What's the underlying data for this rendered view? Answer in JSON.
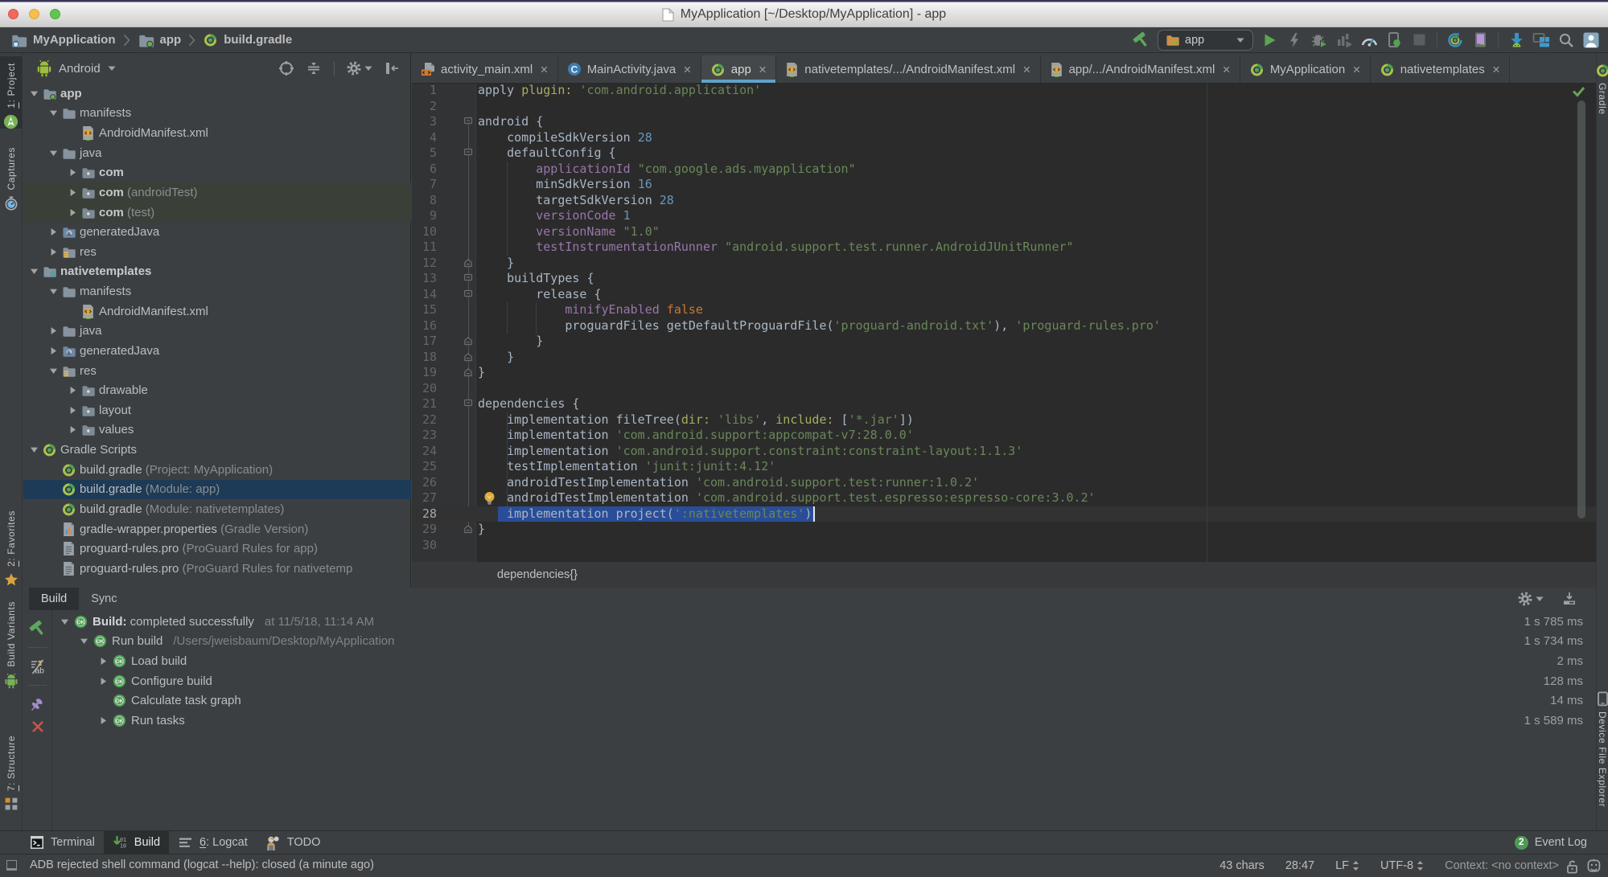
{
  "theme": {
    "panel_bg": "#3C3F41",
    "editor_bg": "#2B2B2B",
    "accent_blue": "#61A1C8",
    "selection_blue": "#2A4D97",
    "tree_selection_blue": "#1D3B57",
    "success_green": "#4D9C54",
    "error_red": "#C75450",
    "string_green": "#6A8759",
    "keyword_orange": "#CC7832",
    "number_blue": "#6897BB",
    "property_purple": "#9876AA"
  },
  "window": {
    "title": "MyApplication [~/Desktop/MyApplication] - app",
    "traffic_lights": [
      "close",
      "minimize",
      "zoom"
    ]
  },
  "navbar": {
    "breadcrumbs": [
      {
        "label": "MyApplication",
        "icon": "project-folder-icon"
      },
      {
        "label": "app",
        "icon": "module-folder-icon"
      },
      {
        "label": "build.gradle",
        "icon": "gradle-icon"
      }
    ],
    "run_config": {
      "label": "app",
      "icon": "run-config-folder-icon"
    },
    "actions": [
      {
        "id": "make",
        "icon": "hammer-icon"
      },
      {
        "id": "run-config-combo",
        "combo": true
      },
      {
        "id": "run",
        "icon": "run-icon"
      },
      {
        "id": "apply-changes",
        "icon": "lightning-icon"
      },
      {
        "id": "debug",
        "icon": "debug-icon"
      },
      {
        "id": "profile",
        "icon": "profile-icon"
      },
      {
        "id": "profiler",
        "icon": "gauge-icon"
      },
      {
        "id": "attach-debugger",
        "icon": "attach-debugger-icon"
      },
      {
        "id": "stop",
        "icon": "stop-icon"
      },
      {
        "sep": true
      },
      {
        "id": "sync-project",
        "icon": "gradle-sync-icon"
      },
      {
        "id": "layout-inspector",
        "icon": "layout-inspector-icon"
      },
      {
        "sep": true
      },
      {
        "id": "sdk-manager",
        "icon": "sdk-manager-icon"
      },
      {
        "id": "avd-manager",
        "icon": "avd-manager-icon"
      },
      {
        "id": "search-everywhere",
        "icon": "search-icon"
      },
      {
        "id": "profile-account",
        "icon": "avatar-icon"
      }
    ]
  },
  "left_stripe": {
    "top": [
      {
        "label": "1: Project",
        "icon": "android-studio-icon",
        "selected": true,
        "mnemonic": true
      },
      {
        "label": "Captures",
        "icon": "captures-icon"
      }
    ],
    "bottom": [
      {
        "label": "2: Favorites",
        "icon": "star-icon",
        "mnemonic": true
      },
      {
        "label": "Build Variants",
        "icon": "android-robot-icon"
      },
      {
        "label": "7: Structure",
        "icon": "structure-icon",
        "mnemonic": true
      }
    ]
  },
  "right_stripe": {
    "top": [
      {
        "label": "Gradle",
        "icon": "gradle-icon"
      }
    ],
    "bottom": [
      {
        "label": "Device File Explorer",
        "icon": "device-explorer-icon"
      }
    ]
  },
  "project_panel": {
    "view_selector": "Android",
    "header_actions": [
      "locate-icon",
      "collapse-all-icon",
      "separator",
      "gear-icon",
      "hide-panel-icon"
    ],
    "tree": [
      {
        "label": "app",
        "icon": "module-app-folder-icon",
        "level": 0,
        "arrow": "expanded",
        "bold": true
      },
      {
        "label": "manifests",
        "icon": "folder-icon",
        "level": 1,
        "arrow": "expanded"
      },
      {
        "label": "AndroidManifest.xml",
        "icon": "manifest-file-icon",
        "level": 2,
        "arrow": "none"
      },
      {
        "label": "java",
        "icon": "folder-icon",
        "level": 1,
        "arrow": "expanded"
      },
      {
        "label": "com",
        "icon": "package-icon",
        "level": 2,
        "arrow": "collapsed",
        "bold": true
      },
      {
        "label": "com",
        "suffix": " (androidTest)",
        "icon": "package-icon",
        "level": 2,
        "arrow": "collapsed",
        "bold": true,
        "highlight": true
      },
      {
        "label": "com",
        "suffix": " (test)",
        "icon": "package-icon",
        "level": 2,
        "arrow": "collapsed",
        "bold": true,
        "highlight": true
      },
      {
        "label": "generatedJava",
        "icon": "generated-folder-icon",
        "level": 1,
        "arrow": "collapsed"
      },
      {
        "label": "res",
        "icon": "res-folder-icon",
        "level": 1,
        "arrow": "collapsed"
      },
      {
        "label": "nativetemplates",
        "icon": "module-lib-folder-icon",
        "level": 0,
        "arrow": "expanded",
        "bold": true
      },
      {
        "label": "manifests",
        "icon": "folder-icon",
        "level": 1,
        "arrow": "expanded"
      },
      {
        "label": "AndroidManifest.xml",
        "icon": "manifest-file-icon",
        "level": 2,
        "arrow": "none"
      },
      {
        "label": "java",
        "icon": "folder-icon",
        "level": 1,
        "arrow": "collapsed"
      },
      {
        "label": "generatedJava",
        "icon": "generated-folder-icon",
        "level": 1,
        "arrow": "collapsed"
      },
      {
        "label": "res",
        "icon": "res-folder-icon",
        "level": 1,
        "arrow": "expanded"
      },
      {
        "label": "drawable",
        "icon": "package-icon",
        "level": 2,
        "arrow": "collapsed"
      },
      {
        "label": "layout",
        "icon": "package-icon",
        "level": 2,
        "arrow": "collapsed"
      },
      {
        "label": "values",
        "icon": "package-icon",
        "level": 2,
        "arrow": "collapsed"
      },
      {
        "label": "Gradle Scripts",
        "icon": "gradle-icon",
        "level": 0,
        "arrow": "expanded"
      },
      {
        "label": "build.gradle",
        "suffix": " (Project: MyApplication)",
        "icon": "gradle-icon",
        "level": 1,
        "arrow": "none"
      },
      {
        "label": "build.gradle",
        "suffix": " (Module: app)",
        "icon": "gradle-icon",
        "level": 1,
        "arrow": "none",
        "selected": true
      },
      {
        "label": "build.gradle",
        "suffix": " (Module: nativetemplates)",
        "icon": "gradle-icon",
        "level": 1,
        "arrow": "none"
      },
      {
        "label": "gradle-wrapper.properties",
        "suffix": " (Gradle Version)",
        "icon": "properties-file-icon",
        "level": 1,
        "arrow": "none"
      },
      {
        "label": "proguard-rules.pro",
        "suffix": " (ProGuard Rules for app)",
        "icon": "text-file-icon",
        "level": 1,
        "arrow": "none"
      },
      {
        "label": "proguard-rules.pro",
        "suffix": " (ProGuard Rules for nativetemp",
        "icon": "text-file-icon",
        "level": 1,
        "arrow": "none"
      }
    ]
  },
  "editor": {
    "tabs": [
      {
        "label": "activity_main.xml",
        "icon": "layout-file-icon"
      },
      {
        "label": "MainActivity.java",
        "icon": "class-file-icon"
      },
      {
        "label": "app",
        "icon": "gradle-icon",
        "selected": true
      },
      {
        "label": "nativetemplates/.../AndroidManifest.xml",
        "icon": "manifest-file-icon"
      },
      {
        "label": "app/.../AndroidManifest.xml",
        "icon": "manifest-file-icon"
      },
      {
        "label": "MyApplication",
        "icon": "gradle-icon"
      },
      {
        "label": "nativetemplates",
        "icon": "gradle-icon"
      }
    ],
    "breadcrumb": "dependencies{}",
    "caret_line": 28,
    "selection": {
      "line": 28,
      "text": "implementation project(':nativetemplates')"
    },
    "lightbulb_line": 27,
    "lines": [
      {
        "n": 1,
        "fold": "none",
        "tokens": [
          [
            "pln",
            "apply "
          ],
          [
            "mk",
            "plugin:"
          ],
          [
            "pln",
            " "
          ],
          [
            "str",
            "'com.android.application'"
          ]
        ]
      },
      {
        "n": 2,
        "fold": "none",
        "tokens": []
      },
      {
        "n": 3,
        "fold": "start",
        "tokens": [
          [
            "pln",
            "android {"
          ]
        ]
      },
      {
        "n": 4,
        "fold": "none",
        "tokens": [
          [
            "pln",
            "    compileSdkVersion "
          ],
          [
            "num",
            "28"
          ]
        ]
      },
      {
        "n": 5,
        "fold": "start",
        "tokens": [
          [
            "pln",
            "    defaultConfig {"
          ]
        ]
      },
      {
        "n": 6,
        "fold": "none",
        "tokens": [
          [
            "pln",
            "        "
          ],
          [
            "prop",
            "applicationId"
          ],
          [
            "pln",
            " "
          ],
          [
            "str",
            "\"com.google.ads.myapplication\""
          ]
        ]
      },
      {
        "n": 7,
        "fold": "none",
        "tokens": [
          [
            "pln",
            "        minSdkVersion "
          ],
          [
            "num",
            "16"
          ]
        ]
      },
      {
        "n": 8,
        "fold": "none",
        "tokens": [
          [
            "pln",
            "        targetSdkVersion "
          ],
          [
            "num",
            "28"
          ]
        ]
      },
      {
        "n": 9,
        "fold": "none",
        "tokens": [
          [
            "pln",
            "        "
          ],
          [
            "prop",
            "versionCode"
          ],
          [
            "pln",
            " "
          ],
          [
            "num",
            "1"
          ]
        ]
      },
      {
        "n": 10,
        "fold": "none",
        "tokens": [
          [
            "pln",
            "        "
          ],
          [
            "prop",
            "versionName"
          ],
          [
            "pln",
            " "
          ],
          [
            "str",
            "\"1.0\""
          ]
        ]
      },
      {
        "n": 11,
        "fold": "none",
        "tokens": [
          [
            "pln",
            "        "
          ],
          [
            "prop",
            "testInstrumentationRunner"
          ],
          [
            "pln",
            " "
          ],
          [
            "str",
            "\"android.support.test.runner.AndroidJUnitRunner\""
          ]
        ]
      },
      {
        "n": 12,
        "fold": "end",
        "tokens": [
          [
            "pln",
            "    }"
          ]
        ]
      },
      {
        "n": 13,
        "fold": "start",
        "tokens": [
          [
            "pln",
            "    buildTypes {"
          ]
        ]
      },
      {
        "n": 14,
        "fold": "start",
        "tokens": [
          [
            "pln",
            "        release {"
          ]
        ]
      },
      {
        "n": 15,
        "fold": "none",
        "tokens": [
          [
            "pln",
            "            "
          ],
          [
            "prop",
            "minifyEnabled"
          ],
          [
            "pln",
            " "
          ],
          [
            "kw",
            "false"
          ]
        ]
      },
      {
        "n": 16,
        "fold": "none",
        "tokens": [
          [
            "pln",
            "            proguardFiles getDefaultProguardFile("
          ],
          [
            "str",
            "'proguard-android.txt'"
          ],
          [
            "pln",
            "), "
          ],
          [
            "str",
            "'proguard-rules.pro'"
          ]
        ]
      },
      {
        "n": 17,
        "fold": "end",
        "tokens": [
          [
            "pln",
            "        }"
          ]
        ]
      },
      {
        "n": 18,
        "fold": "end",
        "tokens": [
          [
            "pln",
            "    }"
          ]
        ]
      },
      {
        "n": 19,
        "fold": "end",
        "tokens": [
          [
            "pln",
            "}"
          ]
        ]
      },
      {
        "n": 20,
        "fold": "none",
        "tokens": []
      },
      {
        "n": 21,
        "fold": "start",
        "tokens": [
          [
            "pln",
            "dependencies {"
          ]
        ]
      },
      {
        "n": 22,
        "fold": "none",
        "tokens": [
          [
            "pln",
            "    implementation fileTree("
          ],
          [
            "mk",
            "dir:"
          ],
          [
            "pln",
            " "
          ],
          [
            "str",
            "'libs'"
          ],
          [
            "pln",
            ", "
          ],
          [
            "mk",
            "include:"
          ],
          [
            "pln",
            " ["
          ],
          [
            "str",
            "'*.jar'"
          ],
          [
            "pln",
            "])"
          ]
        ]
      },
      {
        "n": 23,
        "fold": "none",
        "tokens": [
          [
            "pln",
            "    implementation "
          ],
          [
            "str",
            "'com.android.support:appcompat-v7:28.0.0'"
          ]
        ]
      },
      {
        "n": 24,
        "fold": "none",
        "tokens": [
          [
            "pln",
            "    implementation "
          ],
          [
            "str",
            "'com.android.support.constraint:constraint-layout:1.1.3'"
          ]
        ]
      },
      {
        "n": 25,
        "fold": "none",
        "tokens": [
          [
            "pln",
            "    testImplementation "
          ],
          [
            "str",
            "'junit:junit:4.12'"
          ]
        ]
      },
      {
        "n": 26,
        "fold": "none",
        "tokens": [
          [
            "pln",
            "    androidTestImplementation "
          ],
          [
            "str",
            "'com.android.support.test:runner:1.0.2'"
          ]
        ]
      },
      {
        "n": 27,
        "fold": "none",
        "tokens": [
          [
            "pln",
            "    androidTestImplementation "
          ],
          [
            "str",
            "'com.android.support.test.espresso:espresso-core:3.0.2'"
          ]
        ]
      },
      {
        "n": 28,
        "fold": "none",
        "tokens": [
          [
            "pln",
            "    implementation project("
          ],
          [
            "str",
            "':nativetemplates'"
          ],
          [
            "pln",
            ")"
          ]
        ]
      },
      {
        "n": 29,
        "fold": "end",
        "tokens": [
          [
            "pln",
            "}"
          ]
        ]
      },
      {
        "n": 30,
        "fold": "none",
        "tokens": []
      }
    ]
  },
  "build_panel": {
    "tabs": [
      {
        "label": "Build",
        "selected": true
      },
      {
        "label": "Sync"
      }
    ],
    "toolbar": [
      "hammer-icon",
      "separator",
      "filter-text-icon",
      "separator",
      "pin-icon",
      "close-red-icon"
    ],
    "header_actions": [
      "gear-icon",
      "hide-panel-down-icon"
    ],
    "rows": [
      {
        "level": 0,
        "arrow": "expanded",
        "icon": "ok-icon",
        "bold": "Build:",
        "text": " completed successfully",
        "meta": "at 11/5/18, 11:14 AM",
        "duration": "1 s 785 ms"
      },
      {
        "level": 1,
        "arrow": "expanded",
        "icon": "ok-icon",
        "text": "Run build",
        "meta": "/Users/jweisbaum/Desktop/MyApplication",
        "duration": "1 s 734 ms"
      },
      {
        "level": 2,
        "arrow": "collapsed",
        "icon": "ok-icon",
        "text": "Load build",
        "duration": "2 ms"
      },
      {
        "level": 2,
        "arrow": "collapsed",
        "icon": "ok-icon",
        "text": "Configure build",
        "duration": "128 ms"
      },
      {
        "level": 2,
        "arrow": "none",
        "icon": "ok-icon",
        "text": "Calculate task graph",
        "duration": "14 ms"
      },
      {
        "level": 2,
        "arrow": "collapsed",
        "icon": "ok-icon",
        "text": "Run tasks",
        "duration": "1 s 589 ms"
      }
    ]
  },
  "bottom_stripe": {
    "left": [
      {
        "label": "Terminal",
        "icon": "terminal-icon"
      },
      {
        "label": "Build",
        "icon": "build-tool-icon",
        "selected": true
      },
      {
        "label": "6: Logcat",
        "icon": "logcat-icon",
        "mnemonic": true
      },
      {
        "label": "TODO",
        "icon": "todo-icon"
      }
    ],
    "right": [
      {
        "label": "Event Log",
        "icon": "event-log-badge",
        "badge": "2"
      }
    ]
  },
  "status_bar": {
    "message": "ADB rejected shell command (logcat --help): closed (a minute ago)",
    "items": [
      {
        "label": "43 chars"
      },
      {
        "label": "28:47"
      },
      {
        "label": "LF",
        "updown": true
      },
      {
        "label": "UTF-8",
        "updown": true
      },
      {
        "label": "Context: <no context>",
        "dim": true
      }
    ]
  }
}
